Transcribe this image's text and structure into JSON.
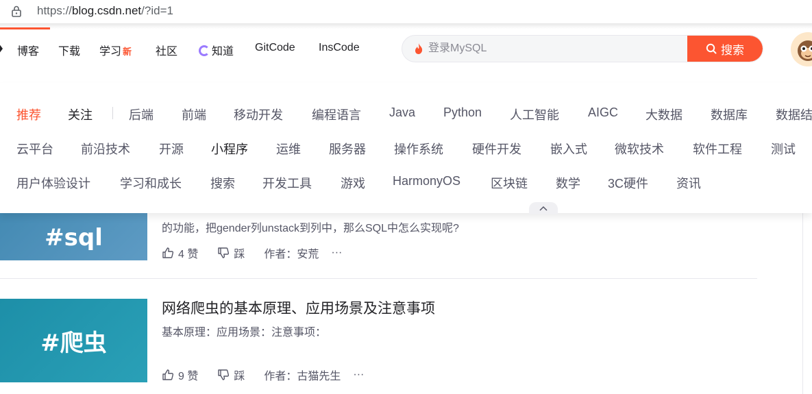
{
  "browser": {
    "url_scheme": "https://",
    "url_host": "blog.csdn.net",
    "url_path": "/?id=1"
  },
  "nav": {
    "items": [
      {
        "label": "博客"
      },
      {
        "label": "下载"
      },
      {
        "label": "学习",
        "badge": "新"
      },
      {
        "label": "社区"
      },
      {
        "label": "知道"
      },
      {
        "label": "GitCode"
      },
      {
        "label": "InsCode"
      }
    ]
  },
  "search": {
    "placeholder": "登录MySQL",
    "button_label": "搜索"
  },
  "categories": {
    "row1": [
      "推荐",
      "关注",
      "后端",
      "前端",
      "移动开发",
      "编程语言",
      "Java",
      "Python",
      "人工智能",
      "AIGC",
      "大数据",
      "数据库",
      "数据结"
    ],
    "row2": [
      "云平台",
      "前沿技术",
      "开源",
      "小程序",
      "运维",
      "服务器",
      "操作系统",
      "硬件开发",
      "嵌入式",
      "微软技术",
      "软件工程",
      "测试"
    ],
    "row3": [
      "用户体验设计",
      "学习和成长",
      "搜索",
      "开发工具",
      "游戏",
      "HarmonyOS",
      "区块链",
      "数学",
      "3C硬件",
      "资讯"
    ]
  },
  "articles": [
    {
      "thumb_text": "#sql",
      "desc": "的功能，把gender列unstack到列中，那么SQL中怎么实现呢?",
      "likes": "4 赞",
      "dislike": "踩",
      "author": "作者：安荒",
      "more": "···"
    },
    {
      "thumb_text": "#爬虫",
      "title": "网络爬虫的基本原理、应用场景及注意事项",
      "desc": "基本原理：应用场景：注意事项：",
      "likes": "9 赞",
      "dislike": "踩",
      "author": "作者：古猫先生",
      "more": "···"
    }
  ],
  "colors": {
    "accent": "#fc5531",
    "text": "#222226",
    "muted": "#555666"
  }
}
